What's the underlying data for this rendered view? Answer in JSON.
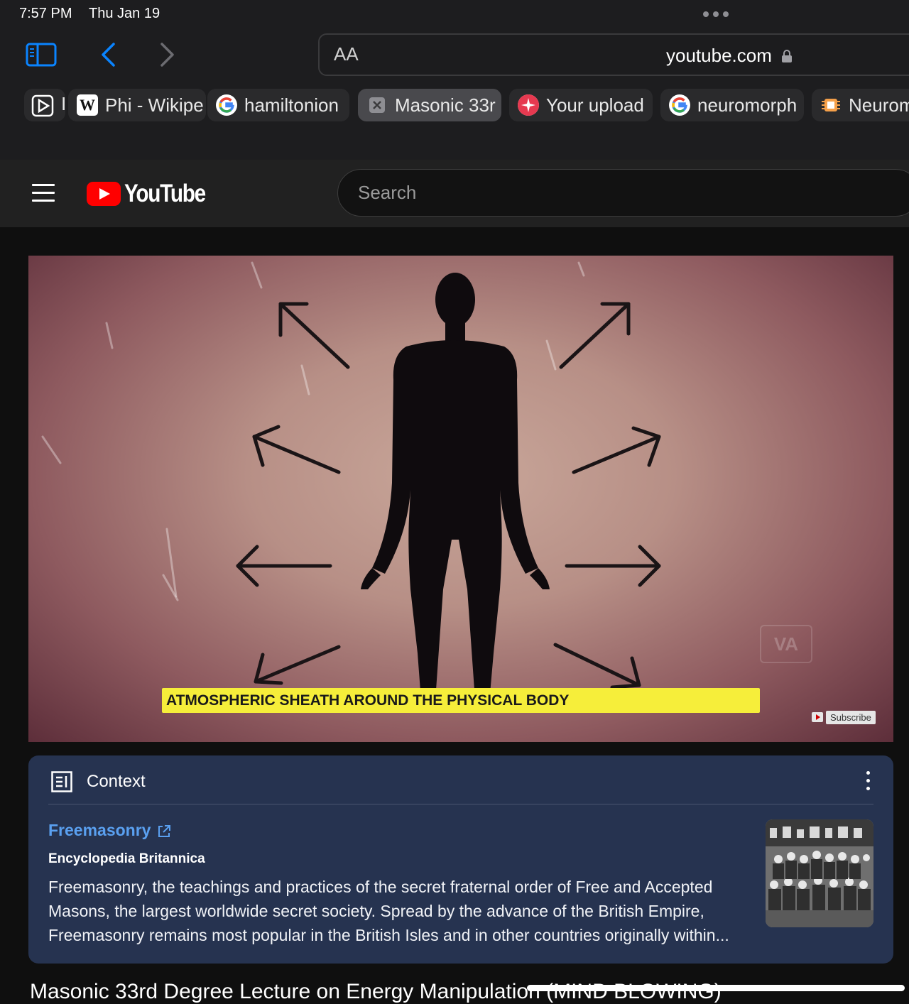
{
  "status_bar": {
    "time": "7:57 PM",
    "date": "Thu Jan 19"
  },
  "address_bar": {
    "text_size_label": "AA",
    "url": "youtube.com"
  },
  "tabs": [
    {
      "label": "Phi - Wikipe",
      "icon": "wikipedia-icon"
    },
    {
      "label": "hamiltonion",
      "icon": "google-icon"
    },
    {
      "label": "Masonic 33r",
      "icon": "close-icon",
      "active": true
    },
    {
      "label": "Your upload",
      "icon": "upload-app-icon"
    },
    {
      "label": "neuromorph",
      "icon": "google-icon"
    },
    {
      "label": "Neurom",
      "icon": "chip-icon"
    }
  ],
  "youtube": {
    "logo_text": "YouTube",
    "search_placeholder": "Search"
  },
  "video": {
    "caption": "ATMOSPHERIC SHEATH AROUND THE PHYSICAL BODY",
    "subscribe_label": "Subscribe",
    "watermark": "VA"
  },
  "context_panel": {
    "heading": "Context",
    "link_text": "Freemasonry",
    "source": "Encyclopedia Britannica",
    "body": "Freemasonry, the teachings and practices of the secret fraternal order of Free and Accepted Masons, the largest worldwide secret society. Spread by the advance of the British Empire, Freemasonry remains most popular in the British Isles and in other countries originally within..."
  },
  "video_title": "Masonic 33rd Degree Lecture on Energy Manipulation (MIND BLOWING)",
  "colors": {
    "youtube_red": "#ff0000",
    "caption_yellow": "#f6ee3a",
    "context_bg": "#263350",
    "link_blue": "#5aa0f0"
  }
}
